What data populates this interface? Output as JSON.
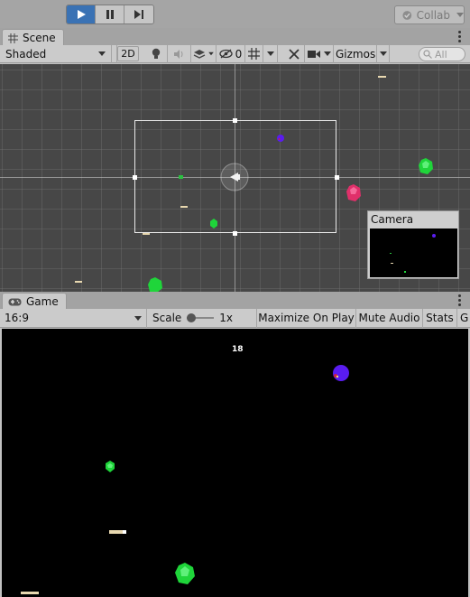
{
  "toolbar": {
    "play_icon": "play-icon",
    "pause_icon": "pause-icon",
    "step_icon": "step-icon",
    "collab_label": "Collab",
    "colors": {
      "play_active": "#3a72b4"
    }
  },
  "scene": {
    "tab_label": "Scene",
    "draw_mode": "Shaded",
    "mode_2d": "2D",
    "hidden_count": "0",
    "gizmos_label": "Gizmos",
    "search_placeholder": "All",
    "camera_preview_title": "Camera Preview"
  },
  "game": {
    "tab_label": "Game",
    "aspect": "16:9",
    "scale_label": "Scale",
    "scale_value": "1x",
    "maximize_label": "Maximize On Play",
    "mute_label": "Mute Audio",
    "stats_label": "Stats",
    "gizmos_partial": "G",
    "score": "18"
  }
}
